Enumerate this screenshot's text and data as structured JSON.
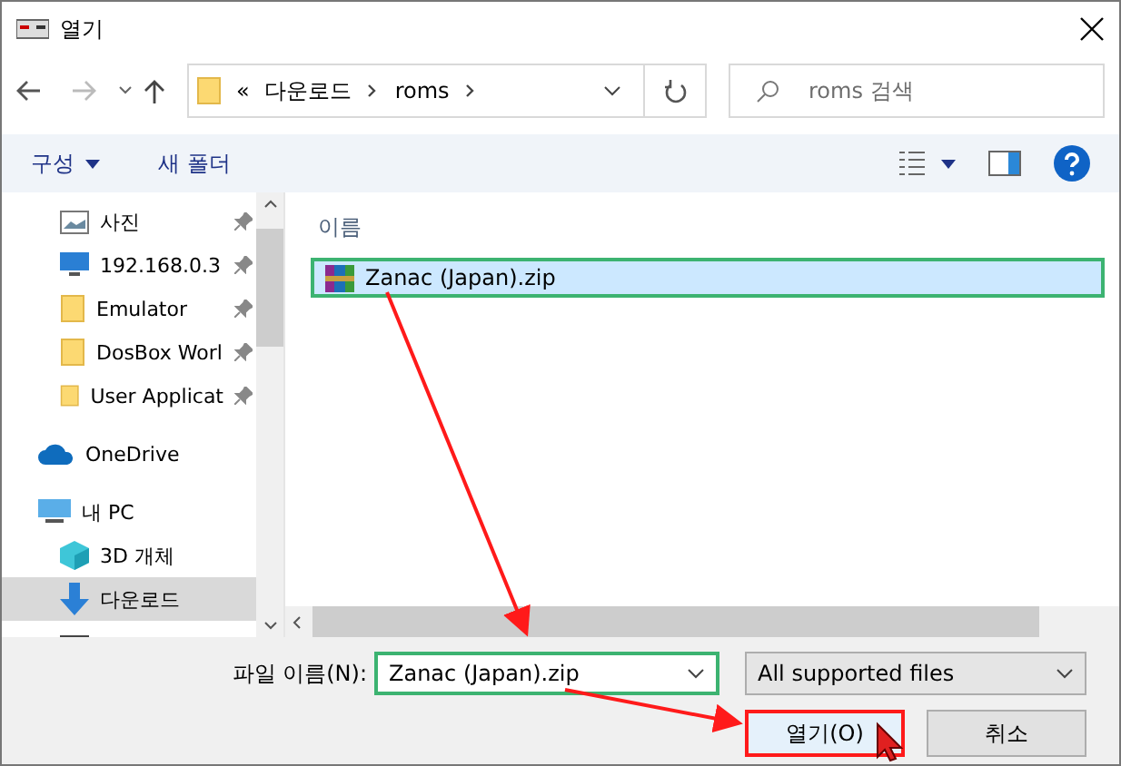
{
  "window": {
    "title": "열기"
  },
  "nav": {
    "back_disabled": false,
    "forward_disabled": true,
    "path_prefix": "«",
    "path": [
      "다운로드",
      "roms"
    ],
    "search_placeholder": "roms 검색"
  },
  "toolbar": {
    "organize": "구성",
    "new_folder": "새 폴더"
  },
  "sidebar": {
    "items": [
      {
        "kind": "photos",
        "label": "사진",
        "pinned": true,
        "selected": false
      },
      {
        "kind": "network",
        "label": "192.168.0.3",
        "pinned": true,
        "selected": false
      },
      {
        "kind": "folder",
        "label": "Emulator",
        "pinned": true,
        "selected": false
      },
      {
        "kind": "folder",
        "label": "DosBox Worl",
        "pinned": true,
        "selected": false
      },
      {
        "kind": "folder",
        "label": "User Applicat",
        "pinned": true,
        "selected": false
      },
      {
        "kind": "onedrive",
        "label": "OneDrive",
        "pinned": false,
        "selected": false
      },
      {
        "kind": "pc",
        "label": "내 PC",
        "pinned": false,
        "selected": false
      },
      {
        "kind": "cube",
        "label": "3D 개체",
        "pinned": false,
        "selected": false
      },
      {
        "kind": "download",
        "label": "다운로드",
        "pinned": false,
        "selected": true
      }
    ]
  },
  "files": {
    "column": "이름",
    "items": [
      {
        "name": "Zanac (Japan).zip",
        "selected": true
      }
    ]
  },
  "bottom": {
    "filename_label": "파일 이름(N):",
    "filename": "Zanac (Japan).zip",
    "filetype": "All supported files",
    "buttons": [
      {
        "label": "열기(O)",
        "kind": "primary"
      },
      {
        "label": "취소",
        "kind": "normal"
      }
    ]
  }
}
